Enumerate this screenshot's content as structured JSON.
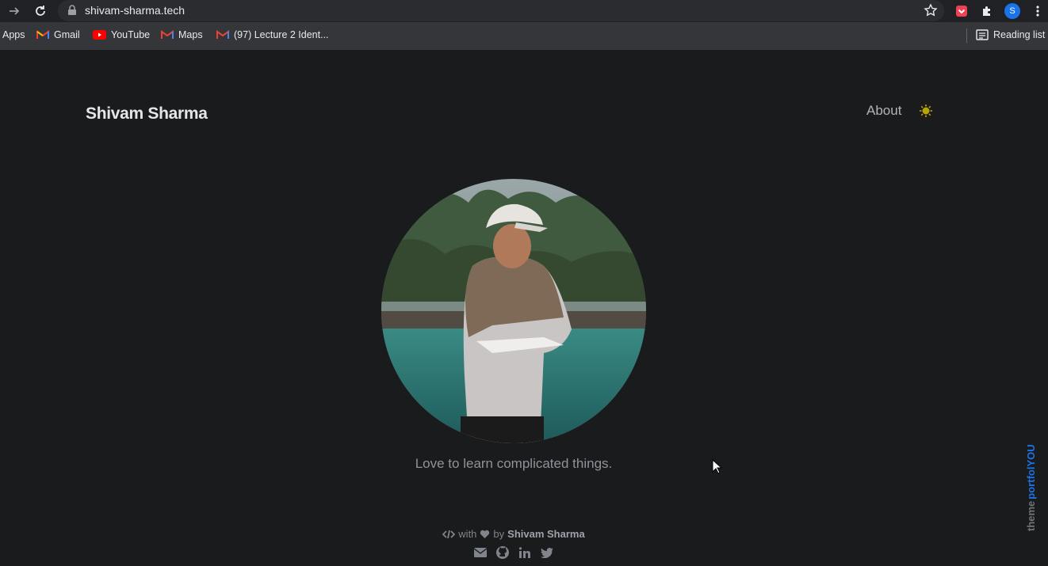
{
  "browser": {
    "url": "shivam-sharma.tech",
    "profile_initial": "S",
    "bookmarks": [
      {
        "label": "Apps",
        "icon": "apps-grid-icon"
      },
      {
        "label": "Gmail",
        "icon": "gmail-icon"
      },
      {
        "label": "YouTube",
        "icon": "youtube-icon"
      },
      {
        "label": "Maps",
        "icon": "maps-icon"
      },
      {
        "label": "(97) Lecture 2 Ident...",
        "icon": "gmail-icon"
      }
    ],
    "reading_list": "Reading list"
  },
  "site": {
    "brand": "Shivam Sharma",
    "nav": {
      "about": "About"
    },
    "tagline": "Love to learn complicated things.",
    "footer": {
      "with": "with",
      "by": "by",
      "author": "Shivam Sharma"
    },
    "theme_credit_prefix": "theme",
    "theme_credit_name": "portfolYOU"
  },
  "colors": {
    "background": "#1a1b1d",
    "accent_toggle": "#b8a30a",
    "theme_credit_blue": "#1a73e8"
  }
}
